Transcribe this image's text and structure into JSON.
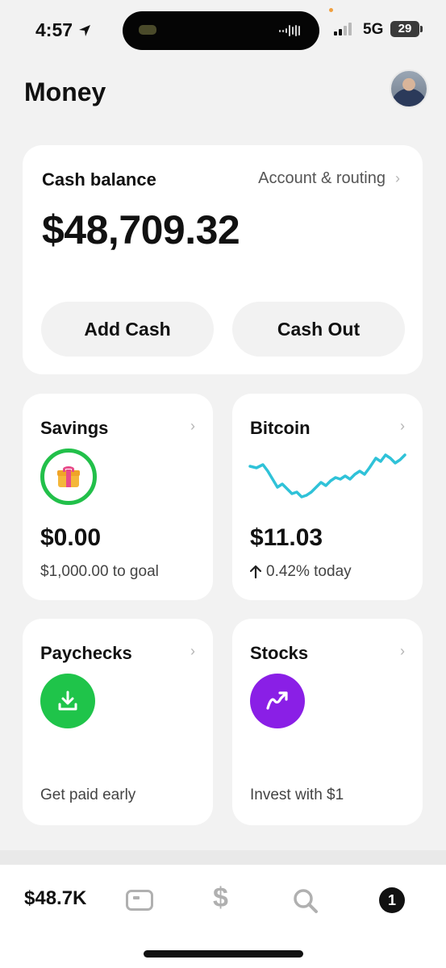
{
  "status_bar": {
    "time": "4:57",
    "network": "5G",
    "battery": "29",
    "icons": [
      "location-arrow-icon",
      "signal-bars-icon"
    ]
  },
  "header": {
    "title": "Money",
    "avatar": "profile-photo"
  },
  "cash_card": {
    "label": "Cash balance",
    "routing_link": "Account & routing",
    "balance": "$48,709.32",
    "add_cash": "Add Cash",
    "cash_out": "Cash Out"
  },
  "tiles": {
    "savings": {
      "title": "Savings",
      "amount": "$0.00",
      "sub": "$1,000.00 to goal",
      "icon": "gift-icon",
      "ring_color": "#22c04a"
    },
    "bitcoin": {
      "title": "Bitcoin",
      "amount": "$11.03",
      "sub": "0.42% today",
      "trend_icon": "arrow-up-icon",
      "line_color": "#2fc2d8"
    },
    "paychecks": {
      "title": "Paychecks",
      "foot": "Get paid early",
      "icon": "download-icon",
      "icon_bg": "#1fc44a"
    },
    "stocks": {
      "title": "Stocks",
      "foot": "Invest with $1",
      "icon": "trend-up-icon",
      "icon_bg": "#8a1fe6"
    }
  },
  "tab_bar": {
    "balance": "$48.7K",
    "activity_count": "1",
    "icons": [
      "card-icon",
      "dollar-icon",
      "search-icon",
      "activity-icon"
    ]
  },
  "chevron": "›"
}
